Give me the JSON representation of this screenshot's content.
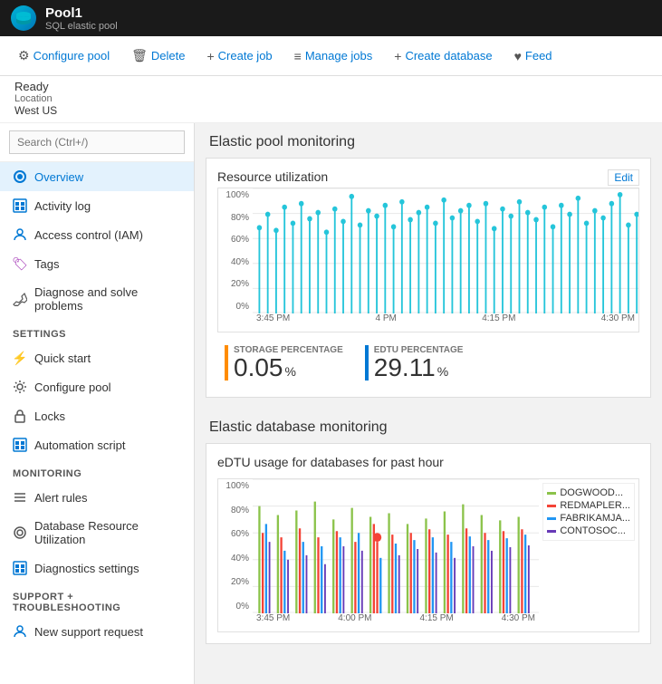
{
  "header": {
    "title": "Pool1",
    "subtitle": "SQL elastic pool",
    "icon": "🗄"
  },
  "toolbar": {
    "buttons": [
      {
        "id": "configure-pool",
        "label": "Configure pool",
        "icon": "⚙"
      },
      {
        "id": "delete",
        "label": "Delete",
        "icon": "🗑"
      },
      {
        "id": "create-job",
        "label": "Create job",
        "icon": "+"
      },
      {
        "id": "manage-jobs",
        "label": "Manage jobs",
        "icon": "≡"
      },
      {
        "id": "create-database",
        "label": "Create database",
        "icon": "+"
      },
      {
        "id": "feed",
        "label": "Feed",
        "icon": "♥"
      }
    ]
  },
  "status": {
    "state": "Ready",
    "location_label": "Location",
    "location": "West US"
  },
  "sidebar": {
    "search_placeholder": "Search (Ctrl+/)",
    "items": [
      {
        "id": "overview",
        "label": "Overview",
        "icon": "◉",
        "active": true,
        "color": "#0078d4"
      },
      {
        "id": "activity-log",
        "label": "Activity log",
        "icon": "▦",
        "color": "#0078d4"
      },
      {
        "id": "access-control",
        "label": "Access control (IAM)",
        "icon": "👤",
        "color": "#0078d4"
      },
      {
        "id": "tags",
        "label": "Tags",
        "icon": "🏷",
        "color": "#9c27b0"
      },
      {
        "id": "diagnose",
        "label": "Diagnose and solve problems",
        "icon": "🔧",
        "color": "#555"
      }
    ],
    "sections": [
      {
        "title": "SETTINGS",
        "items": [
          {
            "id": "quick-start",
            "label": "Quick start",
            "icon": "⚡",
            "color": "#0078d4"
          },
          {
            "id": "configure-pool",
            "label": "Configure pool",
            "icon": "⚙",
            "color": "#555"
          },
          {
            "id": "locks",
            "label": "Locks",
            "icon": "🔒",
            "color": "#555"
          },
          {
            "id": "automation-script",
            "label": "Automation script",
            "icon": "▦",
            "color": "#0078d4"
          }
        ]
      },
      {
        "title": "MONITORING",
        "items": [
          {
            "id": "alert-rules",
            "label": "Alert rules",
            "icon": "≡",
            "color": "#555"
          },
          {
            "id": "db-resource",
            "label": "Database Resource Utilization",
            "icon": "◎",
            "color": "#555"
          },
          {
            "id": "diagnostics",
            "label": "Diagnostics settings",
            "icon": "▦",
            "color": "#0078d4"
          }
        ]
      },
      {
        "title": "SUPPORT + TROUBLESHOOTING",
        "items": [
          {
            "id": "new-support",
            "label": "New support request",
            "icon": "👤",
            "color": "#0078d4"
          }
        ]
      }
    ]
  },
  "elastic_pool_monitoring": {
    "title": "Elastic pool monitoring",
    "resource_utilization": {
      "title": "Resource utilization",
      "edit_label": "Edit",
      "y_labels": [
        "100%",
        "80%",
        "60%",
        "40%",
        "20%",
        "0%"
      ],
      "x_labels": [
        "3:45 PM",
        "4 PM",
        "4:15 PM",
        "4:30 PM"
      ],
      "metrics": [
        {
          "label": "STORAGE PERCENTAGE",
          "value": "0.05",
          "unit": "%",
          "bar_color": "#ff8c00"
        },
        {
          "label": "EDTU PERCENTAGE",
          "value": "29.11",
          "unit": "%",
          "bar_color": "#0078d4"
        }
      ]
    }
  },
  "elastic_db_monitoring": {
    "title": "Elastic database monitoring",
    "edtu_usage": {
      "title": "eDTU usage for databases for past hour",
      "y_labels": [
        "100%",
        "80%",
        "60%",
        "40%",
        "20%",
        "0%"
      ],
      "x_labels": [
        "3:45 PM",
        "4:00 PM",
        "4:15 PM",
        "4:30 PM"
      ],
      "legend": [
        {
          "label": "DOGWOOD...",
          "color": "#8bc34a"
        },
        {
          "label": "REDMAPLER...",
          "color": "#f44336"
        },
        {
          "label": "FABRIKAMJA...",
          "color": "#2196f3"
        },
        {
          "label": "CONTOSOC...",
          "color": "#673ab7"
        }
      ]
    }
  }
}
